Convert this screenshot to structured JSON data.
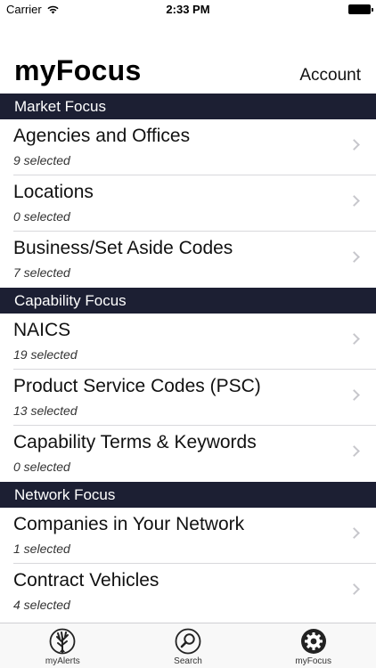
{
  "status_bar": {
    "carrier": "Carrier",
    "time": "2:33 PM"
  },
  "header": {
    "title": "myFocus",
    "account_label": "Account"
  },
  "sections": [
    {
      "title": "Market Focus",
      "items": [
        {
          "title": "Agencies and Offices",
          "subtitle": "9 selected"
        },
        {
          "title": "Locations",
          "subtitle": "0 selected"
        },
        {
          "title": "Business/Set Aside Codes",
          "subtitle": "7 selected"
        }
      ]
    },
    {
      "title": "Capability Focus",
      "items": [
        {
          "title": "NAICS",
          "subtitle": "19 selected"
        },
        {
          "title": "Product Service Codes (PSC)",
          "subtitle": "13 selected"
        },
        {
          "title": "Capability Terms & Keywords",
          "subtitle": "0 selected"
        }
      ]
    },
    {
      "title": "Network Focus",
      "items": [
        {
          "title": "Companies in Your Network",
          "subtitle": "1 selected"
        },
        {
          "title": "Contract Vehicles",
          "subtitle": "4 selected"
        }
      ]
    }
  ],
  "tab_bar": {
    "tabs": [
      {
        "label": "myAlerts",
        "icon": "tree-icon"
      },
      {
        "label": "Search",
        "icon": "search-icon"
      },
      {
        "label": "myFocus",
        "icon": "gear-icon"
      }
    ]
  },
  "colors": {
    "section_header_bg": "#1c1f33",
    "chevron": "#c7c7cc",
    "separator": "#d8d8dc"
  }
}
